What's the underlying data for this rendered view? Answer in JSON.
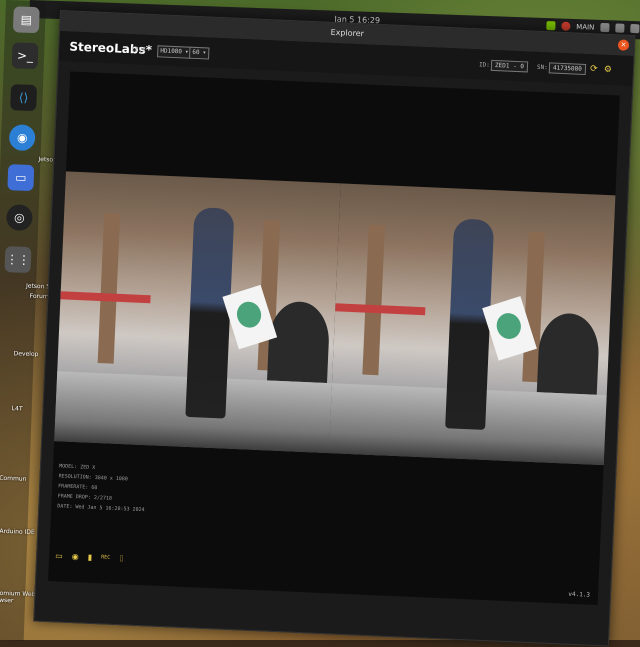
{
  "topbar": {
    "clock": "Jan 5 16:29",
    "tray_label": "MAIN"
  },
  "dock": {
    "items": [
      "files",
      "terminal",
      "vscode",
      "chromium",
      "text-editor",
      "obs"
    ],
    "labels": [
      "Jetson",
      "Jetson S",
      "Forum",
      "Develop",
      "L4T",
      "Commun",
      "Arduino IDE",
      "Chromium Web Browser"
    ]
  },
  "window": {
    "title": "Explorer",
    "close": "×"
  },
  "app": {
    "brand": "StereoLabs*",
    "live": "LIVE",
    "resolution_select": "HD1080",
    "fps_select": "60",
    "id_label": "ID:",
    "id_value": "ZED1 - 0",
    "sn_label": "SN:",
    "sn_value": "41735080"
  },
  "info": {
    "model": "MODEL: ZED X",
    "resolution": "RESOLUTION: 3840 x 1080",
    "framerate": "FRAMERATE: 60",
    "frame_drop": "FRAME DROP: 2/2718",
    "date": "DATE: Wed Jan 5 16:28:53 2024"
  },
  "toolbar": {
    "items": [
      "folder",
      "record",
      "svo",
      "rec-mode",
      "camera"
    ],
    "rec_text": "REC"
  },
  "version": "v4.1.3"
}
